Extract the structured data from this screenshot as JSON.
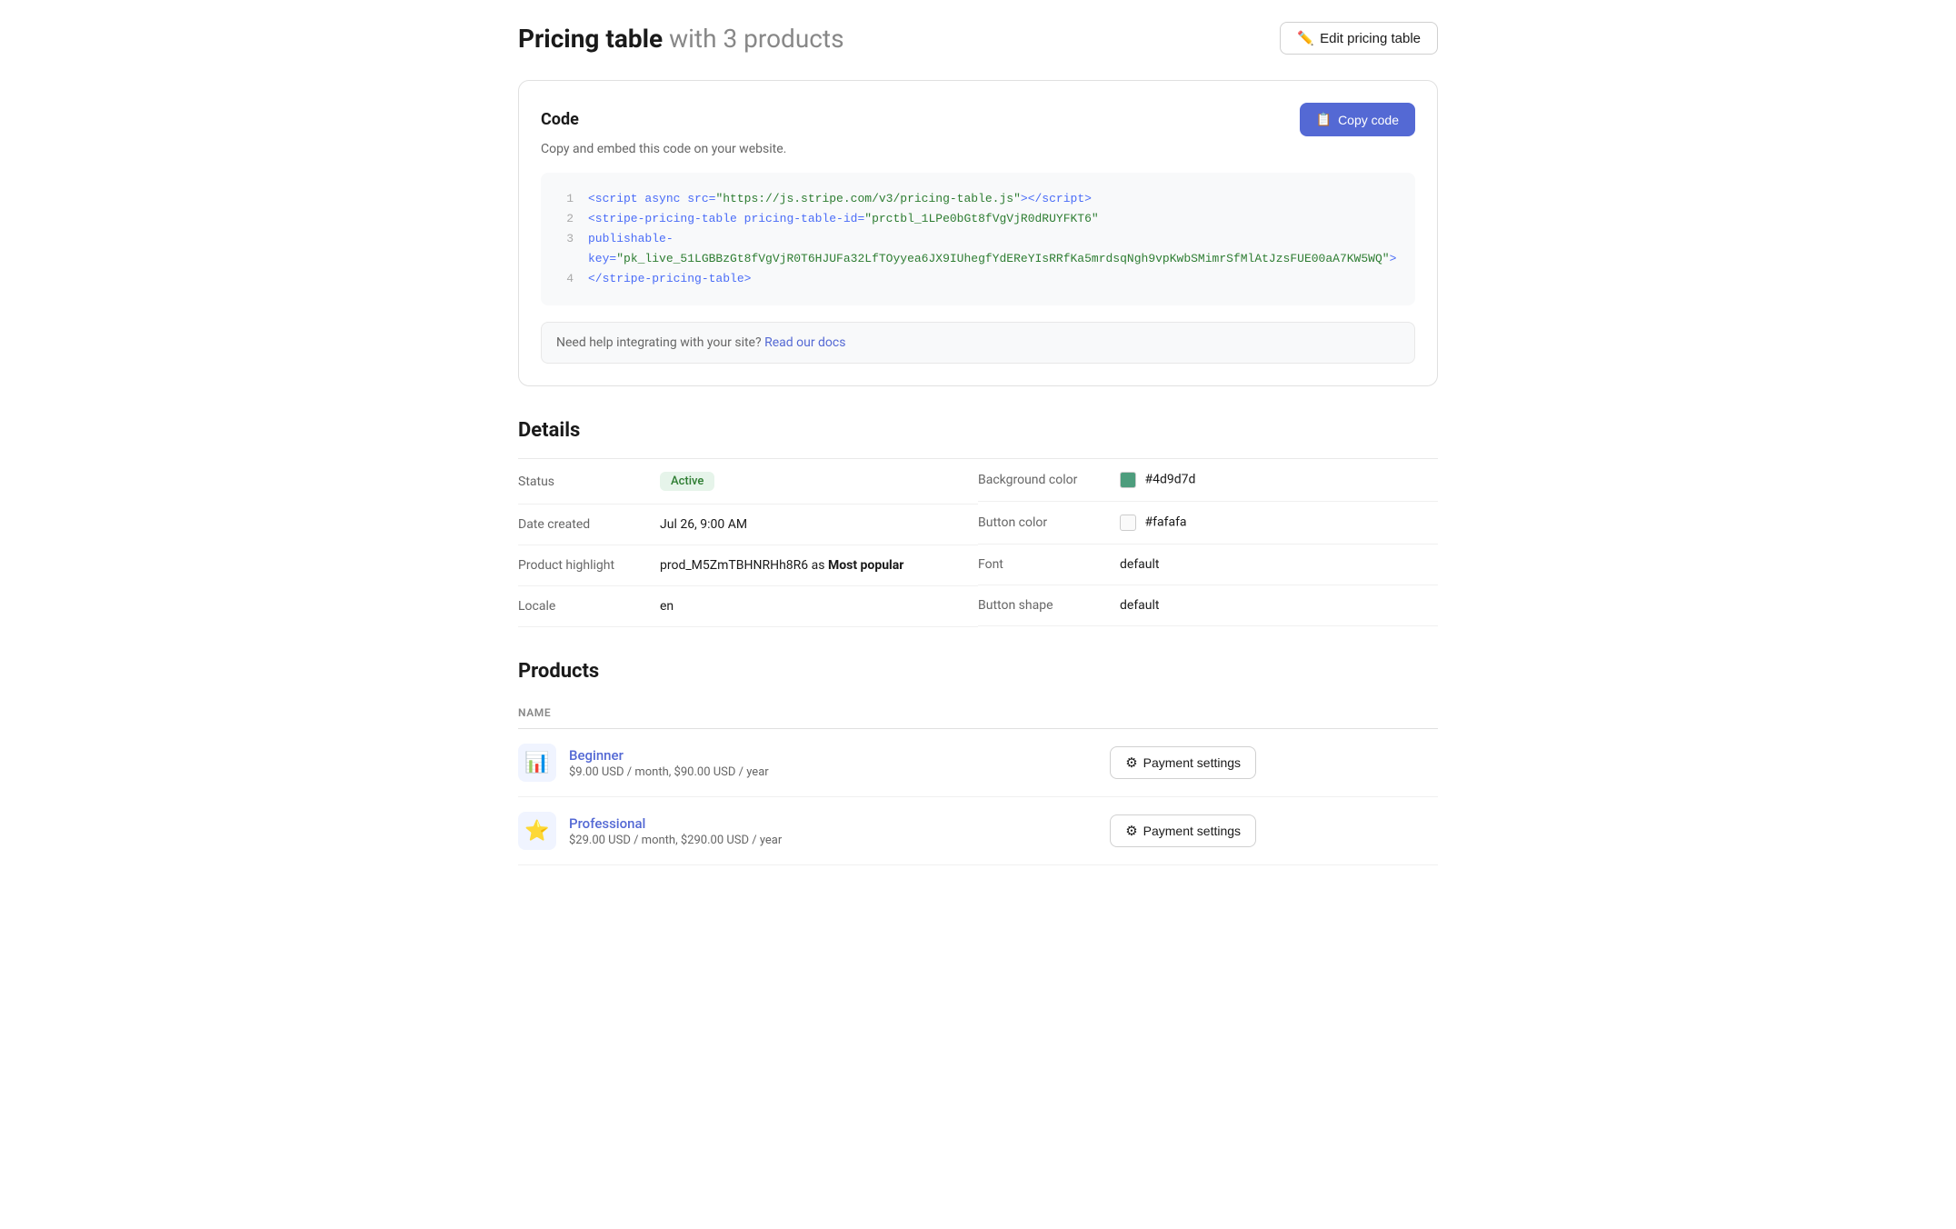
{
  "header": {
    "title": "Pricing table",
    "subtitle": "with 3 products",
    "edit_btn_label": "Edit pricing table",
    "edit_icon": "✏️"
  },
  "code_section": {
    "title": "Code",
    "subtitle": "Copy and embed this code on your website.",
    "copy_btn_label": "Copy code",
    "copy_icon": "📋",
    "lines": [
      {
        "num": "1",
        "content": "<script async src=\"https://js.stripe.com/v3/pricing-table.js\"><\\/script>"
      },
      {
        "num": "2",
        "content": "<stripe-pricing-table pricing-table-id=\"prctbl_1LPe0bGt8fVgVjR0dRUYFKT6\""
      },
      {
        "num": "3",
        "content": "publishable-key=\"pk_live_51LGBBzGt8fVgVjR0T6HJUFa32LfTOyyea6JX9IUhegfYdEReYIsRRfKa5mrdsqNgh9vpKwbSMimrSfMlAtJzsFUE00aA7KW5WQ\">"
      },
      {
        "num": "4",
        "content": "<\\/stripe-pricing-table>"
      }
    ],
    "help_text": "Need help integrating with your site?",
    "help_link_label": "Read our docs",
    "help_link_url": "#"
  },
  "details": {
    "title": "Details",
    "left": [
      {
        "label": "Status",
        "value": "Active",
        "type": "badge"
      },
      {
        "label": "Date created",
        "value": "Jul 26, 9:00 AM",
        "type": "text"
      },
      {
        "label": "Product highlight",
        "value": "prod_M5ZmTBHNRHh8R6",
        "value2": "as",
        "value3": "Most popular",
        "type": "highlight"
      },
      {
        "label": "Locale",
        "value": "en",
        "type": "text"
      }
    ],
    "right": [
      {
        "label": "Background color",
        "value": "#4d9d7d",
        "type": "color",
        "swatch": "#4d9d7d"
      },
      {
        "label": "Button color",
        "value": "#fafafa",
        "type": "color",
        "swatch": "#fafafa"
      },
      {
        "label": "Font",
        "value": "default",
        "type": "text"
      },
      {
        "label": "Button shape",
        "value": "default",
        "type": "text"
      }
    ]
  },
  "products": {
    "title": "Products",
    "col_name": "NAME",
    "items": [
      {
        "name": "Beginner",
        "price": "$9.00 USD / month, $90.00 USD / year",
        "icon": "📊",
        "payment_btn": "Payment settings"
      },
      {
        "name": "Professional",
        "price": "$29.00 USD / month, $290.00 USD / year",
        "icon": "⭐",
        "payment_btn": "Payment settings"
      }
    ]
  }
}
